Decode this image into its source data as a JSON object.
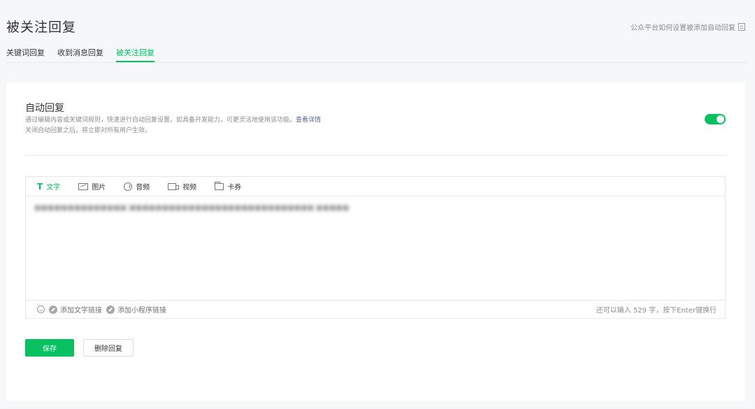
{
  "header": {
    "title": "被关注回复",
    "help_link": "公众平台如何设置被添加自动回复"
  },
  "tabs": [
    {
      "label": "关键词回复"
    },
    {
      "label": "收到消息回复"
    },
    {
      "label": "被关注回复",
      "active": true
    }
  ],
  "auto_reply": {
    "title": "自动回复",
    "desc_line1": "通过编辑内容或关键词规则，快速进行自动回复设置。如具备开发能力，可更灵活地使用该功能。",
    "desc_more": "查看详情",
    "desc_line2": "关闭自动回复之后，将立即对所有用户生效。",
    "enabled": true
  },
  "editor": {
    "types": [
      {
        "label": "文字",
        "icon": "text-icon"
      },
      {
        "label": "图片",
        "icon": "image-icon"
      },
      {
        "label": "音频",
        "icon": "audio-icon"
      },
      {
        "label": "视频",
        "icon": "video-icon"
      },
      {
        "label": "卡券",
        "icon": "coupon-icon"
      }
    ],
    "content": "■■■■■■■■■■■■■■ ■■■■■■■■■■■■■■■■■■■■■■■■■■■■ ■■■■■",
    "add_text_link": "添加文字链接",
    "add_miniprogram_link": "添加小程序链接",
    "counter": "还可以输入 529 字，按下Enter键换行"
  },
  "actions": {
    "save": "保存",
    "delete": "删除回复"
  },
  "colors": {
    "accent": "#07c160",
    "link": "#576b95"
  }
}
